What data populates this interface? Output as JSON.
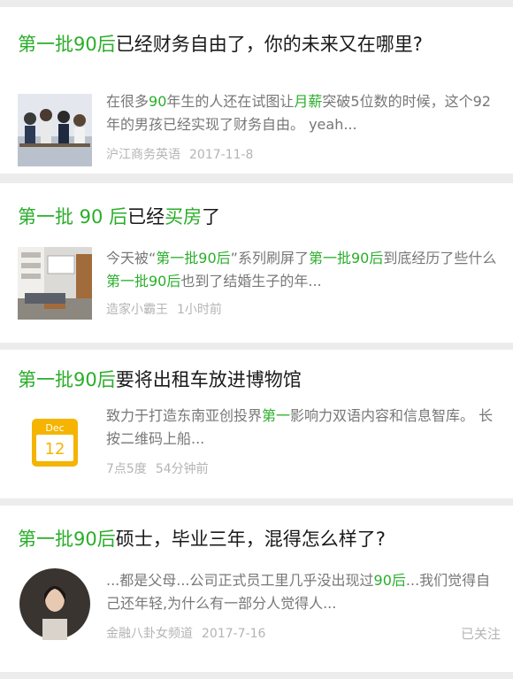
{
  "colors": {
    "highlight": "#2aae2a",
    "text": "#1a1a1a",
    "snippet": "#777777",
    "meta": "#b4b4b4",
    "divider": "#ececec"
  },
  "cards": [
    {
      "title": [
        "第一批90后",
        "已经财务自由了，你的未来又在哪里?"
      ],
      "snippet": [
        "在很多",
        "90",
        "年生的人还在试图让",
        "月薪",
        "突破5位数的时候，这个92年的男孩已经实现了财务自由。 yeah..."
      ],
      "source": "沪江商务英语",
      "time": "2017-11-8",
      "thumb_icon": "group-photo-icon"
    },
    {
      "title": [
        "第一批 90 后",
        "已经",
        "买房",
        "了"
      ],
      "snippet": [
        "今天被“",
        "第一批90后",
        "”系列刷屏了",
        "第一批90后",
        "到底经历了些什么",
        "第一批90后",
        "也到了结婚生子的年..."
      ],
      "source": "造家小霸王",
      "time": "1小时前",
      "thumb_icon": "living-room-photo-icon"
    },
    {
      "title": [
        "第一批90后",
        "要将出租车放进博物馆"
      ],
      "snippet": [
        "致力于打造东南亚创投界",
        "第一",
        "影响力双语内容和信息智库。 长按二维码上船..."
      ],
      "source": "7点5度",
      "time": "54分钟前",
      "thumb_icon": "calendar-icon",
      "calendar": {
        "month": "Dec",
        "day": "12"
      }
    },
    {
      "title": [
        "第一批90后",
        "硕士，毕业三年，混得怎么样了?"
      ],
      "snippet": [
        "...都是父母...公司正式员工里几乎没出现过",
        "90后",
        "...我们觉得自己还年轻,为什么有一部分人觉得人..."
      ],
      "source": "金融八卦女频道",
      "time": "2017-7-16",
      "followed": "已关注",
      "thumb_icon": "avatar-portrait-icon"
    }
  ]
}
